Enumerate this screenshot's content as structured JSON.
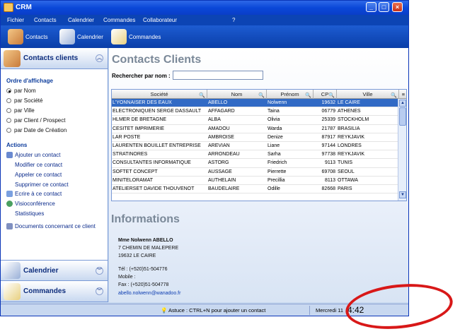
{
  "window": {
    "title": "CRM"
  },
  "menu": [
    "Fichier",
    "Contacts",
    "Calendrier",
    "Commandes",
    "Collaborateur",
    "?"
  ],
  "toolbar": {
    "contacts": "Contacts",
    "calendrier": "Calendrier",
    "commandes": "Commandes"
  },
  "sidebar": {
    "header": "Contacts clients",
    "display_title": "Ordre d'affichage",
    "display_options": [
      "par Nom",
      "par Société",
      "par Ville",
      "par Client / Prospect",
      "par Date de Création"
    ],
    "actions_title": "Actions",
    "actions": [
      "Ajouter un contact",
      "Modifier ce contact",
      "Appeler ce contact",
      "Supprimer ce contact",
      "Ecrire à ce contact",
      "Visioconférence",
      "Statistiques"
    ],
    "documents": "Documents concernant ce client",
    "calendrier": "Calendrier",
    "commandes": "Commandes"
  },
  "main": {
    "title": "Contacts Clients",
    "search_label": "Rechercher par nom :",
    "search_value": "",
    "columns": [
      "Société",
      "Nom",
      "Prénom",
      "CP",
      "Ville"
    ],
    "rows": [
      [
        "L'YONNAISER DES EAUX",
        "ABELLO",
        "Nolwenn",
        "19632",
        "LE CAIRE"
      ],
      [
        "ELECTRONIQUEN SERGE DASSAULT",
        "AFFAGARD",
        "Taina",
        "06779",
        "ATHENES"
      ],
      [
        "HLMER DE BRETAGNE",
        "ALBA",
        "Olivia",
        "25339",
        "STOCKHOLM"
      ],
      [
        "CESITET IMPRIMERIE",
        "AMADOU",
        "Warda",
        "21787",
        "BRASILIA"
      ],
      [
        "LAR POSTE",
        "AMBROISE",
        "Denize",
        "87917",
        "REYKJAVIK"
      ],
      [
        "LAURENTEN BOUILLET ENTREPRISE",
        "AREVIAN",
        "Liane",
        "97144",
        "LONDRES"
      ],
      [
        "STRATINORES",
        "ARRONDEAU",
        "Sarha",
        "97738",
        "REYKJAVIK"
      ],
      [
        "CONSULTANTES INFORMATIQUE",
        "ASTORG",
        "Friedrich",
        "9113",
        "TUNIS"
      ],
      [
        "SOFTET CONCEPT",
        "AUSSAGE",
        "Pierrette",
        "69708",
        "SEOUL"
      ],
      [
        "MINITELORAMAT",
        "AUTHELAIN",
        "Precillia",
        "8113",
        "OTTAWA"
      ],
      [
        "ATELIERSET DAVIDE THOUVENOT",
        "BAUDELAIRE",
        "Odille",
        "82668",
        "PARIS"
      ]
    ]
  },
  "info": {
    "title": "Informations",
    "name": "Mme Nolwenn ABELLO",
    "address1": "7 CHEMIN DE MALEPERE",
    "address2": "19632 LE CAIRE",
    "tel": "Tél : (+520)51-504776",
    "mobile": "Mobile :",
    "fax": "Fax : (+520)51-504778",
    "email": "abello.nolwenn@wanadoo.fr"
  },
  "status": {
    "tip": "Astuce : CTRL+N pour ajouter un contact",
    "date": "Mercredi 11",
    "time": "4:42"
  },
  "colors": {
    "titlebar": "#0a48d8",
    "selection": "#316ac5",
    "annotation": "#d81818"
  }
}
